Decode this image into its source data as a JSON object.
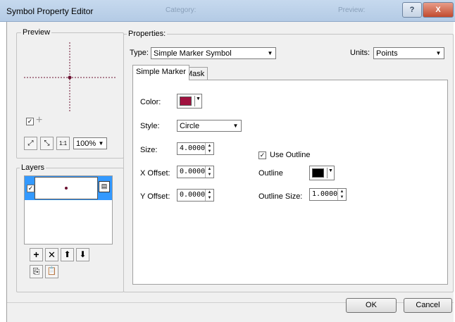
{
  "window": {
    "title": "Symbol Property Editor",
    "bg_ghost_1": "Category:",
    "bg_ghost_2": "Preview:",
    "help_label": "?",
    "close_label": "X"
  },
  "preview": {
    "group_label": "Preview",
    "zoom_value": "100%",
    "add_glyph": "+",
    "zoom_fit_glyph": "⤢",
    "zoom_full_glyph": "⤡",
    "actual_size_glyph": "1:1"
  },
  "layers": {
    "group_label": "Layers",
    "rows": [
      {
        "checked": true,
        "icon": "marker-dot"
      }
    ],
    "buttons": {
      "add": "+",
      "remove": "✕",
      "move_up": "⬆",
      "move_down": "⬇",
      "copy": "⎘",
      "paste": "📋"
    }
  },
  "properties": {
    "group_label": "Properties:",
    "type_label": "Type:",
    "type_value": "Simple Marker Symbol",
    "units_label": "Units:",
    "units_value": "Points",
    "tabs": [
      {
        "label": "Simple Marker",
        "active": true
      },
      {
        "label": "Mask",
        "active": false
      }
    ],
    "color_label": "Color:",
    "color_value": "#a0123f",
    "style_label": "Style:",
    "style_value": "Circle",
    "size_label": "Size:",
    "size_value": "4.0000",
    "xoffset_label": "X Offset:",
    "xoffset_value": "0.0000",
    "yoffset_label": "Y Offset:",
    "yoffset_value": "0.0000",
    "use_outline_label": "Use Outline",
    "use_outline_checked": true,
    "outline_label": "Outline",
    "outline_color": "#000000",
    "outline_size_label": "Outline Size:",
    "outline_size_value": "1.0000"
  },
  "footer": {
    "ok_label": "OK",
    "cancel_label": "Cancel"
  },
  "colors": {
    "marker": "#6b1030",
    "preview_line": "#6b1030",
    "selection": "#3399ff"
  }
}
